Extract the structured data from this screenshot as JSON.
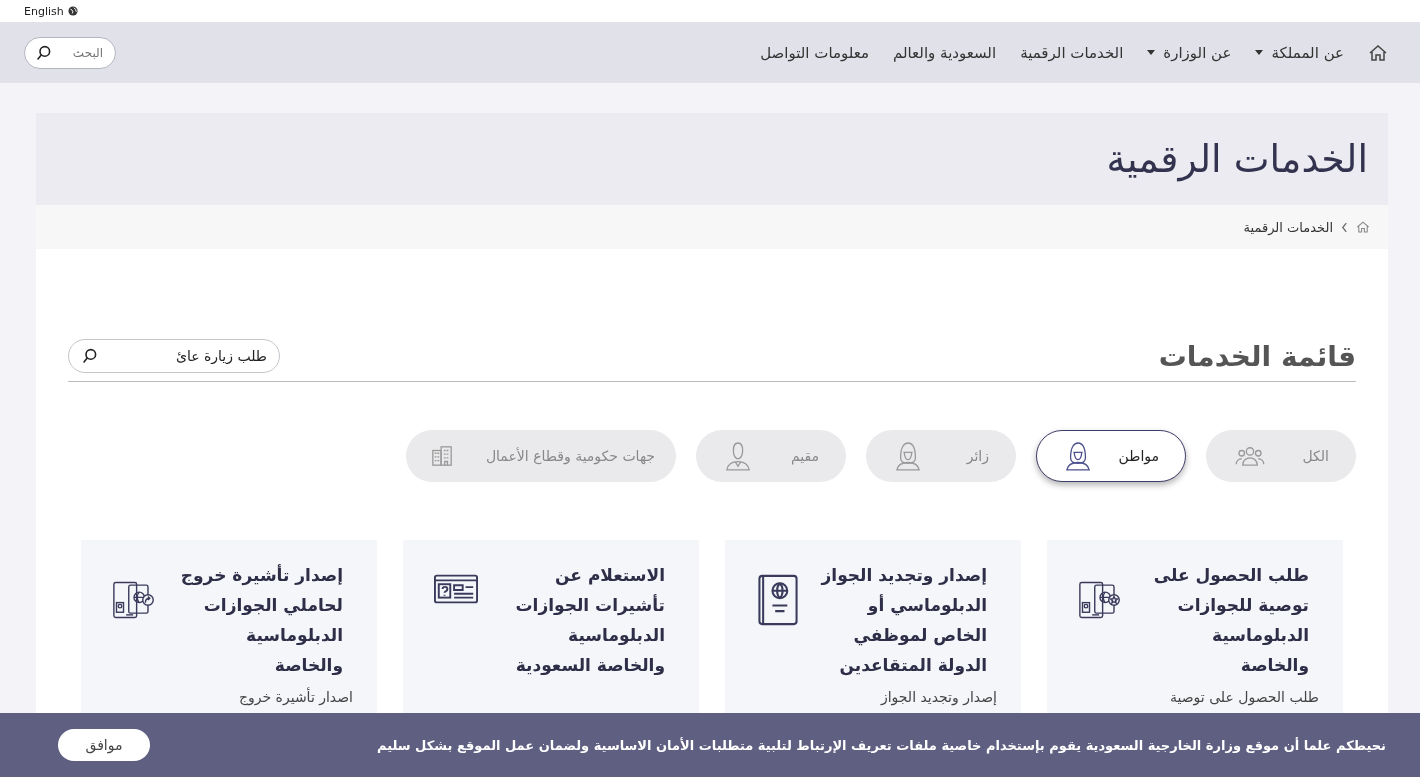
{
  "language_link": "English",
  "nav": {
    "items": [
      {
        "label": "عن المملكة",
        "dropdown": true
      },
      {
        "label": "عن الوزارة",
        "dropdown": true
      },
      {
        "label": "الخدمات الرقمية",
        "dropdown": false
      },
      {
        "label": "السعودية والعالم",
        "dropdown": false
      },
      {
        "label": "معلومات التواصل",
        "dropdown": false
      }
    ],
    "search": {
      "placeholder": "البحث"
    }
  },
  "page_title": "الخدمات الرقمية",
  "breadcrumb": [
    "الخدمات الرقمية"
  ],
  "services": {
    "heading": "قائمة الخدمات",
    "search": {
      "value": "طلب زيارة عائ"
    },
    "filters": [
      {
        "label": "الكل",
        "kind": "group",
        "selected": false
      },
      {
        "label": "مواطن",
        "kind": "citizen",
        "selected": true
      },
      {
        "label": "زائر",
        "kind": "visitor",
        "selected": false
      },
      {
        "label": "مقيم",
        "kind": "resident",
        "selected": false
      },
      {
        "label": "جهات حكومية وقطاع الأعمال",
        "kind": "building",
        "selected": false
      }
    ],
    "cards": [
      {
        "kind": "passport-star",
        "title": "طلب الحصول على توصية للجوازات الدبلوماسية والخاصة",
        "description": "طلب الحصول على توصية"
      },
      {
        "kind": "passport-book",
        "title": "إصدار وتجديد الجواز الدبلوماسي أو الخاص لموظفي الدولة المتقاعدين",
        "description": "إصدار وتجديد الجواز"
      },
      {
        "kind": "id-card",
        "title": "الاستعلام عن تأشيرات الجوازات الدبلوماسية والخاصة السعودية"
      },
      {
        "kind": "passport-exit",
        "title": "إصدار تأشيرة خروج لحاملي الجوازات الدبلوماسية والخاصة",
        "description": "اصدار تأشيرة خروج"
      }
    ]
  },
  "cookie_notice": {
    "text": "نحيطكم علما أن موقع وزارة الخارجية السعودية يقوم بإستخدام خاصية ملفات تعريف الإرتباط لتلبية متطلبات الأمان الاساسية ولضمان عمل الموقع بشكل سليم",
    "button": "موافق"
  }
}
